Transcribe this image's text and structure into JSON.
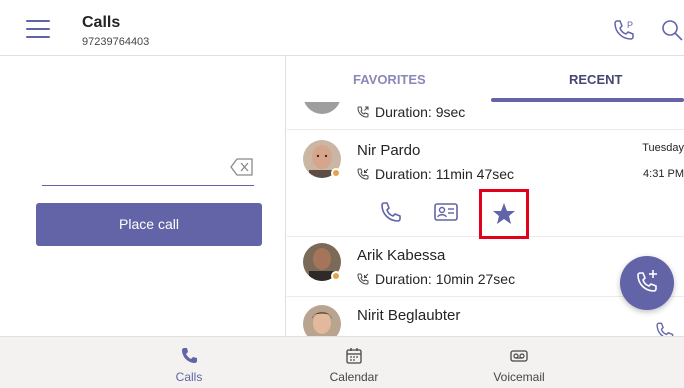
{
  "header": {
    "title": "Calls",
    "subtitle": "97239764403"
  },
  "dialpad": {
    "place_call_label": "Place call"
  },
  "tabs": [
    {
      "label": "FAVORITES",
      "active": false
    },
    {
      "label": "RECENT",
      "active": true
    }
  ],
  "calls": [
    {
      "name": "",
      "duration": "Duration: 9sec",
      "date": "",
      "time": ""
    },
    {
      "name": "Nir Pardo",
      "duration": "Duration: 11min 47sec",
      "date": "Tuesday",
      "time": "4:31 PM"
    },
    {
      "name": "Arik Kabessa",
      "duration": "Duration: 10min 27sec",
      "date": "",
      "time": ""
    },
    {
      "name": "Nirit Beglaubter",
      "duration": "",
      "date": "",
      "time": ""
    }
  ],
  "bottom_nav": [
    {
      "label": "Calls",
      "icon": "phone-icon",
      "active": true
    },
    {
      "label": "Calendar",
      "icon": "calendar-icon",
      "active": false
    },
    {
      "label": "Voicemail",
      "icon": "voicemail-icon",
      "active": false
    }
  ],
  "colors": {
    "accent": "#6264a7",
    "highlight": "#e3001b",
    "presence": "#e8a14b"
  }
}
